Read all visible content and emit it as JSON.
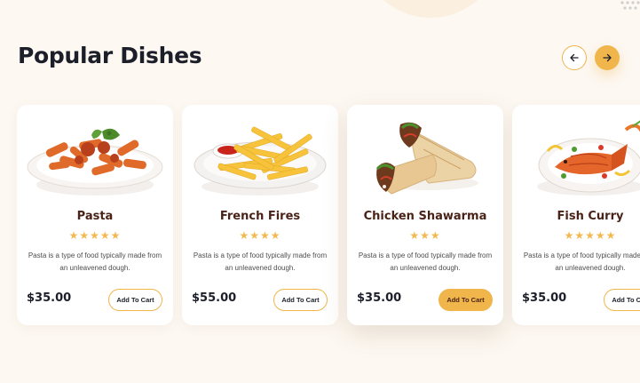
{
  "section": {
    "title": "Popular Dishes"
  },
  "nav": {
    "prev_icon": "arrow-left-icon",
    "next_icon": "arrow-right-icon"
  },
  "colors": {
    "accent": "#f0b54b",
    "title_text": "#1c1f2a",
    "dish_name": "#4a2318",
    "star": "#f3b84f",
    "background": "#fdf8f2"
  },
  "dishes": [
    {
      "name": "Pasta",
      "rating": 5,
      "stars": "★★★★★",
      "description": "Pasta is a type of food typically made from an unleavened dough.",
      "price": "$35.00",
      "button": "Add To Cart",
      "button_active": false,
      "image": "pasta-plate-image"
    },
    {
      "name": "French Fires",
      "rating": 4,
      "stars": "★★★★",
      "description": "Pasta is a type of food typically made from an unleavened dough.",
      "price": "$55.00",
      "button": "Add To Cart",
      "button_active": false,
      "image": "french-fries-plate-image"
    },
    {
      "name": "Chicken Shawarma",
      "rating": 3,
      "stars": "★★★",
      "description": "Pasta is a type of food typically made from an unleavened dough.",
      "price": "$35.00",
      "button": "Add To Cart",
      "button_active": true,
      "image": "shawarma-wrap-image"
    },
    {
      "name": "Fish Curry",
      "rating": 5,
      "stars": "★★★★★",
      "description": "Pasta is a type of food typically made from an unleavened dough.",
      "price": "$35.00",
      "button": "Add To Cart",
      "button_active": false,
      "image": "fish-curry-plate-image"
    }
  ]
}
